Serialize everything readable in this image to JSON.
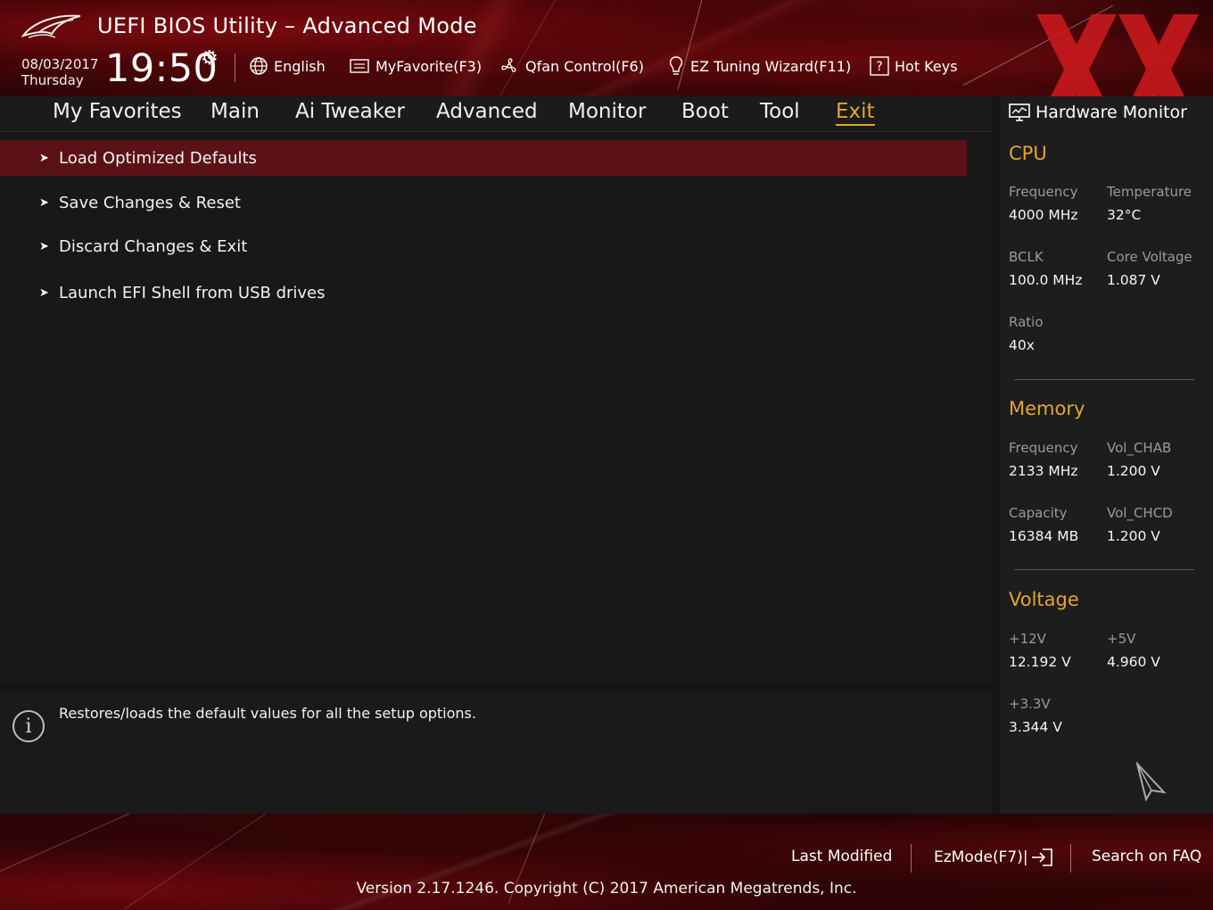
{
  "header": {
    "title": "UEFI BIOS Utility – Advanced Mode",
    "date": "08/03/2017",
    "day": "Thursday",
    "time": "19:50",
    "tools": {
      "language": "English",
      "myfavorite": "MyFavorite(F3)",
      "qfan": "Qfan Control(F6)",
      "ez_tuning": "EZ Tuning Wizard(F11)",
      "hot_keys": "Hot Keys"
    }
  },
  "tabs": [
    {
      "label": "My Favorites"
    },
    {
      "label": "Main"
    },
    {
      "label": "Ai Tweaker"
    },
    {
      "label": "Advanced"
    },
    {
      "label": "Monitor"
    },
    {
      "label": "Boot"
    },
    {
      "label": "Tool"
    },
    {
      "label": "Exit",
      "active": true
    }
  ],
  "exit_menu": {
    "items": [
      {
        "label": "Load Optimized Defaults",
        "selected": true
      },
      {
        "label": "Save Changes & Reset"
      },
      {
        "label": "Discard Changes & Exit"
      },
      {
        "label": "Launch EFI Shell from USB drives"
      }
    ]
  },
  "help": {
    "text": "Restores/loads the default values for all the setup options."
  },
  "hardware_monitor": {
    "title": "Hardware Monitor",
    "cpu": {
      "section": "CPU",
      "frequency_label": "Frequency",
      "frequency": "4000 MHz",
      "temperature_label": "Temperature",
      "temperature": "32°C",
      "bclk_label": "BCLK",
      "bclk": "100.0 MHz",
      "core_voltage_label": "Core Voltage",
      "core_voltage": "1.087 V",
      "ratio_label": "Ratio",
      "ratio": "40x"
    },
    "memory": {
      "section": "Memory",
      "frequency_label": "Frequency",
      "frequency": "2133 MHz",
      "vol_chab_label": "Vol_CHAB",
      "vol_chab": "1.200 V",
      "capacity_label": "Capacity",
      "capacity": "16384 MB",
      "vol_chcd_label": "Vol_CHCD",
      "vol_chcd": "1.200 V"
    },
    "voltage": {
      "section": "Voltage",
      "v12_label": "+12V",
      "v12": "12.192 V",
      "v5_label": "+5V",
      "v5": "4.960 V",
      "v33_label": "+3.3V",
      "v33": "3.344 V"
    }
  },
  "footer": {
    "last_modified": "Last Modified",
    "ezmode": "EzMode(F7)|",
    "search_faq": "Search on FAQ",
    "version": "Version 2.17.1246. Copyright (C) 2017 American Megatrends, Inc."
  },
  "colors": {
    "accent": "#e2a62e",
    "selected_row": "#5a1216",
    "panel": "#1d1d1d"
  }
}
